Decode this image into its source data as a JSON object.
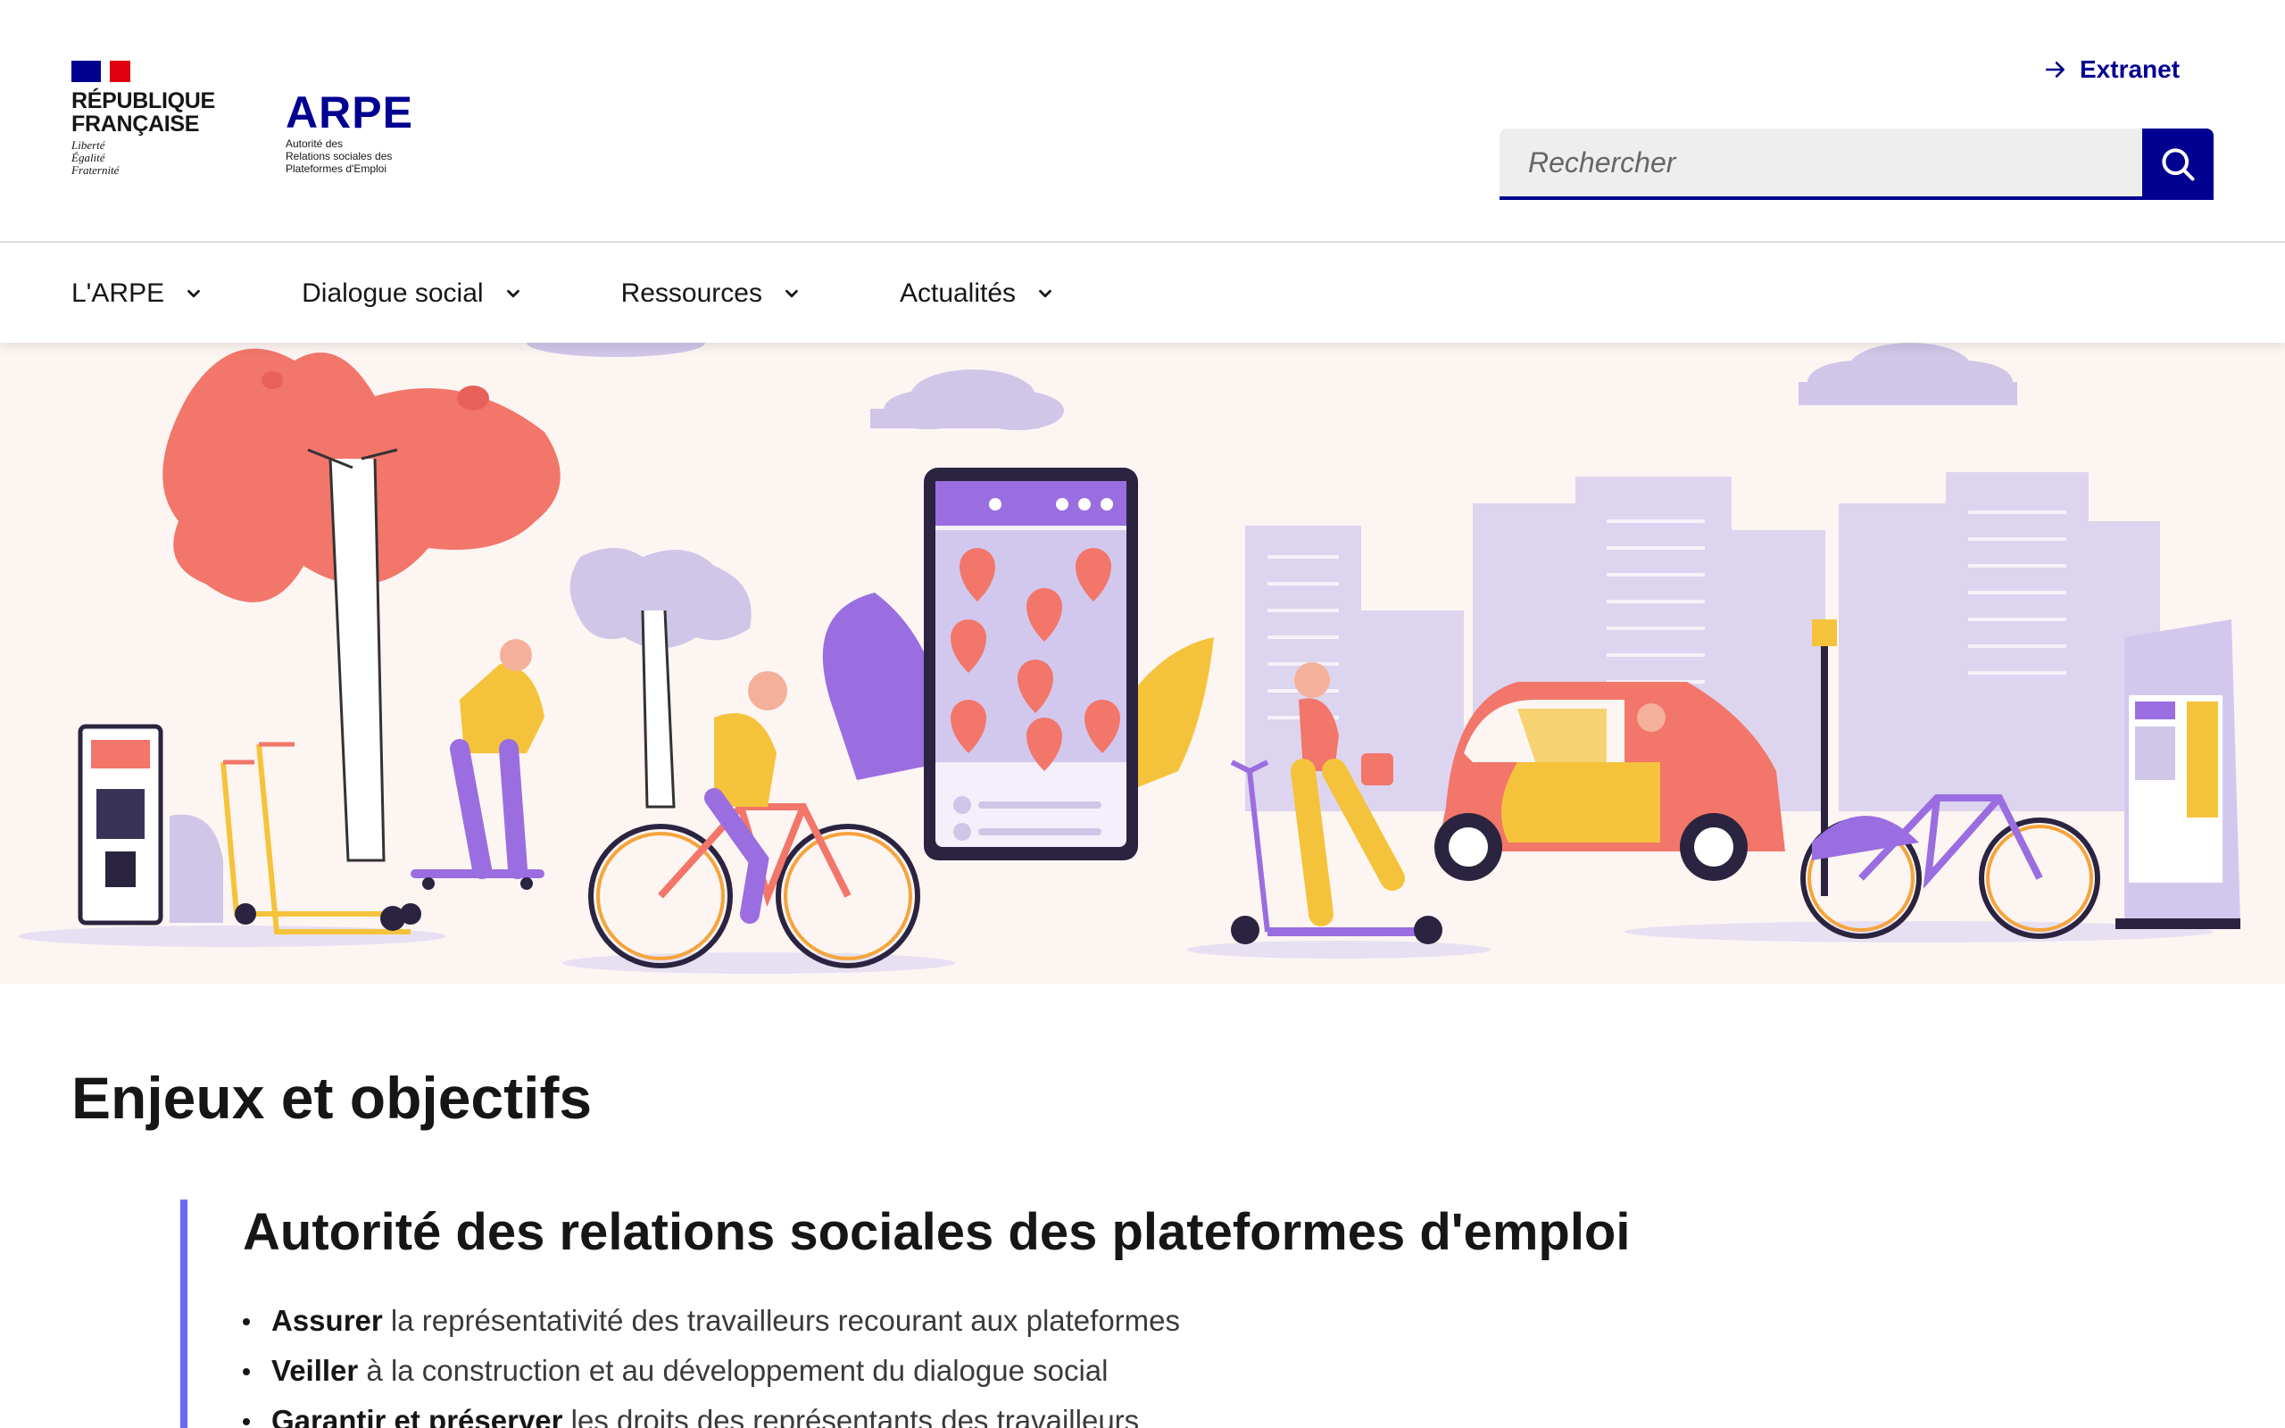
{
  "header": {
    "republique": {
      "name_line1": "RÉPUBLIQUE",
      "name_line2": "FRANÇAISE",
      "motto_line1": "Liberté",
      "motto_line2": "Égalité",
      "motto_line3": "Fraternité"
    },
    "arpe": {
      "wordmark": "ARPE",
      "sub_line1": "Autorité des",
      "sub_line2": "Relations sociales des",
      "sub_line3": "Plateformes d'Emploi"
    },
    "extranet_label": "Extranet",
    "extranet_icon": "arrow-right-icon",
    "search": {
      "placeholder": "Rechercher",
      "button_icon": "search-icon"
    }
  },
  "nav": {
    "items": [
      {
        "label": "L'ARPE"
      },
      {
        "label": "Dialogue social"
      },
      {
        "label": "Ressources"
      },
      {
        "label": "Actualités"
      }
    ],
    "chevron_icon": "chevron-down-icon"
  },
  "hero": {
    "illustration": "urban mobility illustration"
  },
  "content": {
    "title": "Enjeux et objectifs",
    "callout": {
      "title": "Autorité des relations sociales des plateformes d'emploi",
      "items": [
        {
          "bold": "Assurer",
          "text": " la représentativité des travailleurs recourant aux plateformes"
        },
        {
          "bold": "Veiller",
          "text": " à la construction et au développement du dialogue social"
        },
        {
          "bold": "Garantir et préserver",
          "text": " les droits des représentants des travailleurs"
        }
      ]
    }
  },
  "colors": {
    "brand_blue": "#000091",
    "accent_purple": "#6a6af4",
    "flag_red": "#e1000f",
    "hero_bg": "#fdf5f2"
  }
}
